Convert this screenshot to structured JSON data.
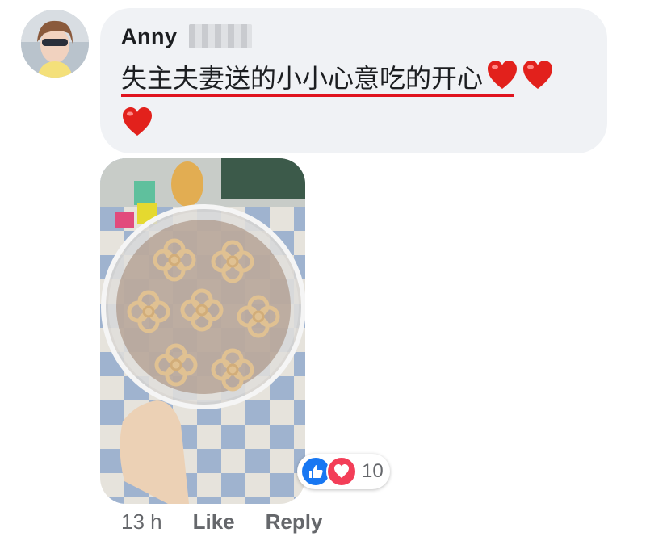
{
  "comment": {
    "author_name": "Anny",
    "text": "失主夫妻送的小小心意吃的开心",
    "emoji_trailing": "heart-emoji x3",
    "attachment": "photo",
    "reaction_count": "10",
    "reaction_types": [
      "like-icon",
      "love-icon"
    ],
    "timestamp": "13 h",
    "actions": {
      "like_label": "Like",
      "reply_label": "Reply"
    }
  },
  "colors": {
    "bubble_bg": "#f0f2f5",
    "text": "#1c1e21",
    "meta_text": "#65676b",
    "underline_red": "#e0141e",
    "like_blue": "#1877f2",
    "love_red": "#f33e58"
  }
}
